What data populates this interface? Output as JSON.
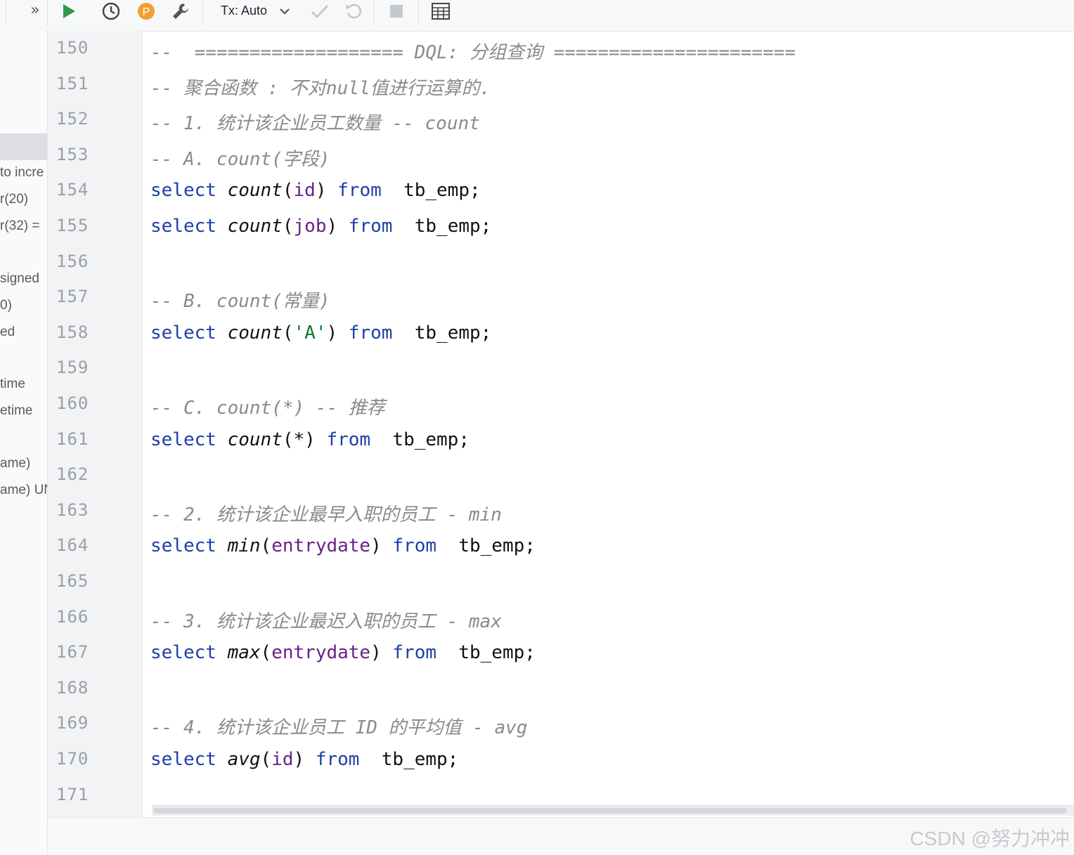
{
  "toolbar": {
    "overflow_label": "»",
    "tx_label": "Tx: Auto",
    "icons": [
      "run-icon",
      "history-icon",
      "profile-icon",
      "settings-wrench-icon",
      "commit-check-icon",
      "rollback-icon",
      "stop-icon",
      "table-view-icon"
    ]
  },
  "tree": {
    "lines": [
      "to incre",
      "r(20)",
      "r(32) =",
      "signed",
      "0)",
      "ed",
      "time",
      "etime",
      "ame)",
      "ame) UN"
    ]
  },
  "editor": {
    "line_numbers": [
      "150",
      "151",
      "152",
      "153",
      "154",
      "155",
      "156",
      "157",
      "158",
      "159",
      "160",
      "161",
      "162",
      "163",
      "164",
      "165",
      "166",
      "167",
      "168",
      "169",
      "170",
      "171"
    ],
    "lines": [
      {
        "n": "150",
        "tokens": [
          {
            "t": "--  =================== DQL: 分组查询 ======================",
            "c": "cm"
          }
        ]
      },
      {
        "n": "151",
        "tokens": [
          {
            "t": "-- 聚合函数 : 不对null值进行运算的.",
            "c": "cm"
          }
        ]
      },
      {
        "n": "152",
        "tokens": [
          {
            "t": "-- 1. 统计该企业员工数量 -- count",
            "c": "cm"
          }
        ]
      },
      {
        "n": "153",
        "tokens": [
          {
            "t": "-- A. count(字段)",
            "c": "cm"
          }
        ]
      },
      {
        "n": "154",
        "tokens": [
          {
            "t": "select",
            "c": "kw"
          },
          {
            "t": " ",
            "c": "tx"
          },
          {
            "t": "count",
            "c": "fn"
          },
          {
            "t": "(",
            "c": "tx"
          },
          {
            "t": "id",
            "c": "id"
          },
          {
            "t": ") ",
            "c": "tx"
          },
          {
            "t": "from",
            "c": "kw"
          },
          {
            "t": "  tb_emp;",
            "c": "tx"
          }
        ]
      },
      {
        "n": "155",
        "tokens": [
          {
            "t": "select",
            "c": "kw"
          },
          {
            "t": " ",
            "c": "tx"
          },
          {
            "t": "count",
            "c": "fn"
          },
          {
            "t": "(",
            "c": "tx"
          },
          {
            "t": "job",
            "c": "id"
          },
          {
            "t": ") ",
            "c": "tx"
          },
          {
            "t": "from",
            "c": "kw"
          },
          {
            "t": "  tb_emp;",
            "c": "tx"
          }
        ]
      },
      {
        "n": "156",
        "tokens": []
      },
      {
        "n": "157",
        "tokens": [
          {
            "t": "-- B. count(常量)",
            "c": "cm"
          }
        ]
      },
      {
        "n": "158",
        "tokens": [
          {
            "t": "select",
            "c": "kw"
          },
          {
            "t": " ",
            "c": "tx"
          },
          {
            "t": "count",
            "c": "fn"
          },
          {
            "t": "(",
            "c": "tx"
          },
          {
            "t": "'A'",
            "c": "str"
          },
          {
            "t": ") ",
            "c": "tx"
          },
          {
            "t": "from",
            "c": "kw"
          },
          {
            "t": "  tb_emp;",
            "c": "tx"
          }
        ]
      },
      {
        "n": "159",
        "tokens": []
      },
      {
        "n": "160",
        "tokens": [
          {
            "t": "-- C. count(*) -- 推荐",
            "c": "cm"
          }
        ]
      },
      {
        "n": "161",
        "tokens": [
          {
            "t": "select",
            "c": "kw"
          },
          {
            "t": " ",
            "c": "tx"
          },
          {
            "t": "count",
            "c": "fn"
          },
          {
            "t": "(*) ",
            "c": "tx"
          },
          {
            "t": "from",
            "c": "kw"
          },
          {
            "t": "  tb_emp;",
            "c": "tx"
          }
        ]
      },
      {
        "n": "162",
        "tokens": []
      },
      {
        "n": "163",
        "tokens": [
          {
            "t": "-- 2. 统计该企业最早入职的员工 - min",
            "c": "cm"
          }
        ]
      },
      {
        "n": "164",
        "tokens": [
          {
            "t": "select",
            "c": "kw"
          },
          {
            "t": " ",
            "c": "tx"
          },
          {
            "t": "min",
            "c": "fn"
          },
          {
            "t": "(",
            "c": "tx"
          },
          {
            "t": "entrydate",
            "c": "id"
          },
          {
            "t": ") ",
            "c": "tx"
          },
          {
            "t": "from",
            "c": "kw"
          },
          {
            "t": "  tb_emp;",
            "c": "tx"
          }
        ]
      },
      {
        "n": "165",
        "tokens": []
      },
      {
        "n": "166",
        "tokens": [
          {
            "t": "-- 3. 统计该企业最迟入职的员工 - max",
            "c": "cm"
          }
        ]
      },
      {
        "n": "167",
        "tokens": [
          {
            "t": "select",
            "c": "kw"
          },
          {
            "t": " ",
            "c": "tx"
          },
          {
            "t": "max",
            "c": "fn"
          },
          {
            "t": "(",
            "c": "tx"
          },
          {
            "t": "entrydate",
            "c": "id"
          },
          {
            "t": ") ",
            "c": "tx"
          },
          {
            "t": "from",
            "c": "kw"
          },
          {
            "t": "  tb_emp;",
            "c": "tx"
          }
        ]
      },
      {
        "n": "168",
        "tokens": []
      },
      {
        "n": "169",
        "tokens": [
          {
            "t": "-- 4. 统计该企业员工 ID 的平均值 - avg",
            "c": "cm"
          }
        ]
      },
      {
        "n": "170",
        "tokens": [
          {
            "t": "select",
            "c": "kw"
          },
          {
            "t": " ",
            "c": "tx"
          },
          {
            "t": "avg",
            "c": "fn"
          },
          {
            "t": "(",
            "c": "tx"
          },
          {
            "t": "id",
            "c": "id"
          },
          {
            "t": ") ",
            "c": "tx"
          },
          {
            "t": "from",
            "c": "kw"
          },
          {
            "t": "  tb_emp;",
            "c": "tx"
          }
        ]
      },
      {
        "n": "171",
        "tokens": []
      }
    ]
  },
  "watermark": "CSDN @努力冲冲",
  "colors": {
    "keyword": "#1d3fa8",
    "identifier": "#6a1f8a",
    "comment": "#8a8a8a",
    "run": "#2e9b45",
    "profile": "#f0a030"
  }
}
